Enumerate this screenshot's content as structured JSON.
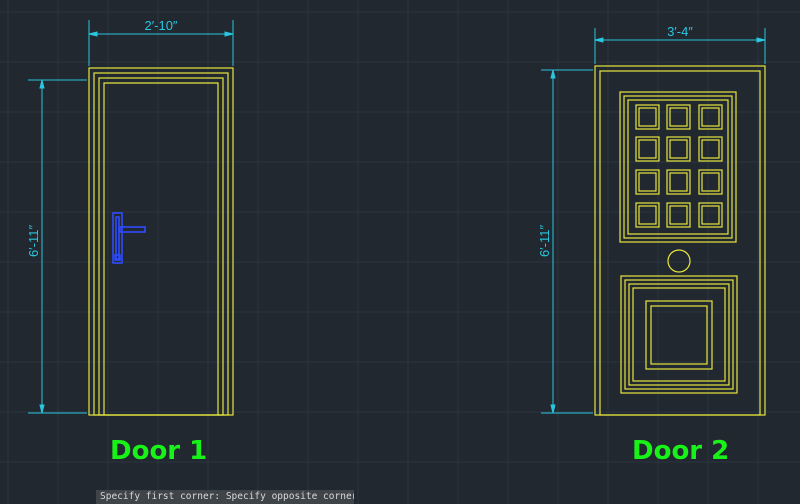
{
  "doors": [
    {
      "label": "Door 1",
      "width_dim": "2′-10″",
      "height_dim": "6′-11″"
    },
    {
      "label": "Door 2",
      "width_dim": "3′-4″",
      "height_dim": "6′-11″"
    }
  ],
  "command_line": {
    "text": "Specify first corner: Specify opposite corner:"
  },
  "colors": {
    "background": "#212830",
    "grid": "#2b3440",
    "geometry": "#e6e63c",
    "dimension": "#29c6e0",
    "handle": "#2f4cff",
    "label": "#19f219"
  }
}
